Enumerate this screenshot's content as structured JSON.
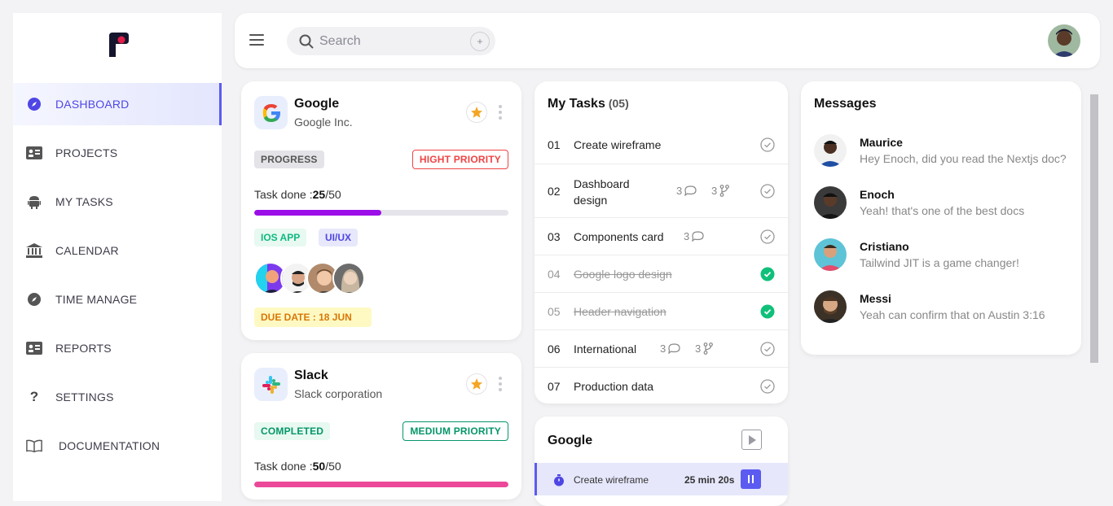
{
  "sidebar": {
    "items": [
      {
        "label": "DASHBOARD",
        "icon": "compass-icon",
        "active": true
      },
      {
        "label": "PROJECTS",
        "icon": "id-card-icon"
      },
      {
        "label": "MY TASKS",
        "icon": "android-icon"
      },
      {
        "label": "CALENDAR",
        "icon": "bank-icon"
      },
      {
        "label": "TIME MANAGE",
        "icon": "compass-icon"
      },
      {
        "label": "REPORTS",
        "icon": "id-card-icon"
      },
      {
        "label": "SETTINGS",
        "icon": "question-icon"
      },
      {
        "label": "DOCUMENTATION",
        "icon": "book-icon"
      }
    ]
  },
  "topbar": {
    "search_placeholder": "Search",
    "add_label": "+"
  },
  "projects": [
    {
      "name": "Google",
      "company": "Google Inc.",
      "status": "PROGRESS",
      "priority": "HIGHT PRIORITY",
      "task_done_label": "Task done :",
      "done": "25",
      "total": "/50",
      "progress": 0.5,
      "tags": [
        "IOS APP",
        "UI/UX"
      ],
      "due": "DUE DATE : 18 JUN"
    },
    {
      "name": "Slack",
      "company": "Slack corporation",
      "status": "COMPLETED",
      "priority": "MEDIUM PRIORITY",
      "task_done_label": "Task done :",
      "done": "50",
      "total": "/50",
      "progress": 1.0
    }
  ],
  "tasks": {
    "title": "My Tasks",
    "count": "(05)",
    "items": [
      {
        "num": "01",
        "label": "Create wireframe",
        "done": false
      },
      {
        "num": "02",
        "label": "Dashboard",
        "label2": "design",
        "comments": "3",
        "branches": "3",
        "done": false
      },
      {
        "num": "03",
        "label": "Components card",
        "comments": "3",
        "done": false
      },
      {
        "num": "04",
        "label": "Google logo design",
        "done": true
      },
      {
        "num": "05",
        "label": "Header navigation",
        "done": true
      },
      {
        "num": "06",
        "label": "International",
        "comments": "3",
        "branches": "3",
        "done": false
      },
      {
        "num": "07",
        "label": "Production data",
        "done": false
      }
    ]
  },
  "timer": {
    "title": "Google",
    "task": "Create wireframe",
    "time": "25 min 20s"
  },
  "messages": {
    "title": "Messages",
    "items": [
      {
        "name": "Maurice",
        "text": "Hey Enoch, did you read the Nextjs doc?"
      },
      {
        "name": "Enoch",
        "text": "Yeah! that's one of the best docs"
      },
      {
        "name": "Cristiano",
        "text": "Tailwind JIT is a game changer!"
      },
      {
        "name": "Messi",
        "text": "Yeah can confirm that on Austin 3:16"
      }
    ]
  },
  "colors": {
    "accent": "#5b5bf1",
    "progress_purple": "#9b0ee8",
    "progress_pink": "#ec4899",
    "success": "#10c07a",
    "danger": "#ef4444"
  }
}
